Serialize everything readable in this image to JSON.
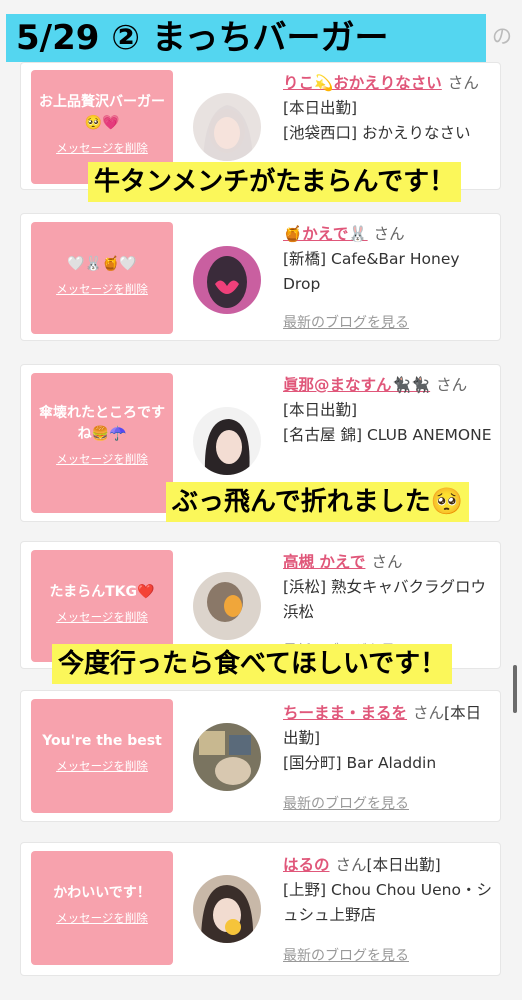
{
  "title": "5/29 ② まっちバーガー",
  "top_edge_char": "の",
  "delete_label": "メッセージを削除",
  "blog_label": "最新のブログを見る",
  "overlays": {
    "o1": "牛タンメンチがたまらんです！",
    "o2": "ぶっ飛んで折れました🥺",
    "o3": "今度行ったら食べてほしいです！"
  },
  "cards": [
    {
      "message": "お上品贅沢バーガー🥺💗",
      "name": "りこ💫おかえりなさい",
      "san": "さん",
      "line1": "[本日出勤]",
      "line2": "[池袋西口] おかえりなさい"
    },
    {
      "message": "🤍🐰🍯🤍",
      "name": "🍯かえで🐰",
      "san": "さん",
      "line1": "[新橋] Cafe&Bar Honey Drop",
      "line2": ""
    },
    {
      "message": "傘壊れたところですね🍔☂️",
      "name": "眞那@まなすん🐈‍⬛🐈‍⬛",
      "san": "さん",
      "line1": "[本日出勤]",
      "line2": "[名古屋 錦] CLUB ANEMONE"
    },
    {
      "message": "たまらんTKG❤️",
      "name": "高槻 かえで",
      "san": "さん",
      "line1": "[浜松] 熟女キャバクラグロウ 浜松",
      "line2": ""
    },
    {
      "message": "You're the best",
      "name": "ちーまま・まるを",
      "san": "さん",
      "line1": "[本日出勤]",
      "line2": "[国分町] Bar Aladdin"
    },
    {
      "message": "かわいいです！",
      "name": "はるの",
      "san": "さん",
      "line1": "[本日出勤]",
      "line2": "[上野] Chou Chou Ueno・シュシュ上野店"
    }
  ],
  "colors": {
    "banner": "#54d6f0",
    "pink_box": "#f7a2ad",
    "name_pink": "#e0577a",
    "highlight": "#fbf75a"
  }
}
